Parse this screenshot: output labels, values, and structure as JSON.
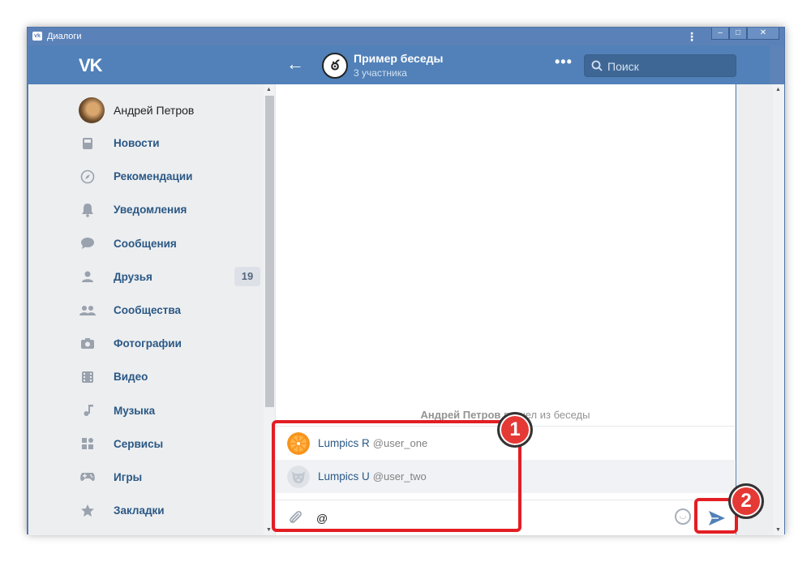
{
  "window": {
    "title": "Диалоги",
    "controls": [
      "‒",
      "□",
      "✕"
    ]
  },
  "header": {
    "logo": "VK",
    "chat_title": "Пример беседы",
    "chat_subtitle": "3 участника",
    "search_placeholder": "Поиск"
  },
  "sidebar": {
    "profile_name": "Андрей Петров",
    "items": [
      {
        "label": "Новости",
        "icon": "news-icon"
      },
      {
        "label": "Рекомендации",
        "icon": "compass-icon"
      },
      {
        "label": "Уведомления",
        "icon": "bell-icon"
      },
      {
        "label": "Сообщения",
        "icon": "chat-bubble-icon"
      },
      {
        "label": "Друзья",
        "icon": "user-icon",
        "badge": "19"
      },
      {
        "label": "Сообщества",
        "icon": "group-icon"
      },
      {
        "label": "Фотографии",
        "icon": "camera-icon"
      },
      {
        "label": "Видео",
        "icon": "film-icon"
      },
      {
        "label": "Музыка",
        "icon": "music-note-icon"
      },
      {
        "label": "Сервисы",
        "icon": "grid-icon"
      },
      {
        "label": "Игры",
        "icon": "gamepad-icon"
      },
      {
        "label": "Закладки",
        "icon": "star-icon"
      }
    ]
  },
  "chat": {
    "system_message": {
      "author": "Андрей Петров",
      "text": "вышел из беседы"
    },
    "mentions": [
      {
        "name": "Lumpics R",
        "handle": "@user_one",
        "icon": "orange-avatar"
      },
      {
        "name": "Lumpics U",
        "handle": "@user_two",
        "icon": "dog-avatar"
      }
    ],
    "input_value": "@"
  },
  "annotations": {
    "marker_1": "1",
    "marker_2": "2"
  },
  "colors": {
    "header": "#5181b8",
    "sidebar": "#edeef0",
    "link": "#2a5885",
    "highlight": "#e31e24"
  }
}
